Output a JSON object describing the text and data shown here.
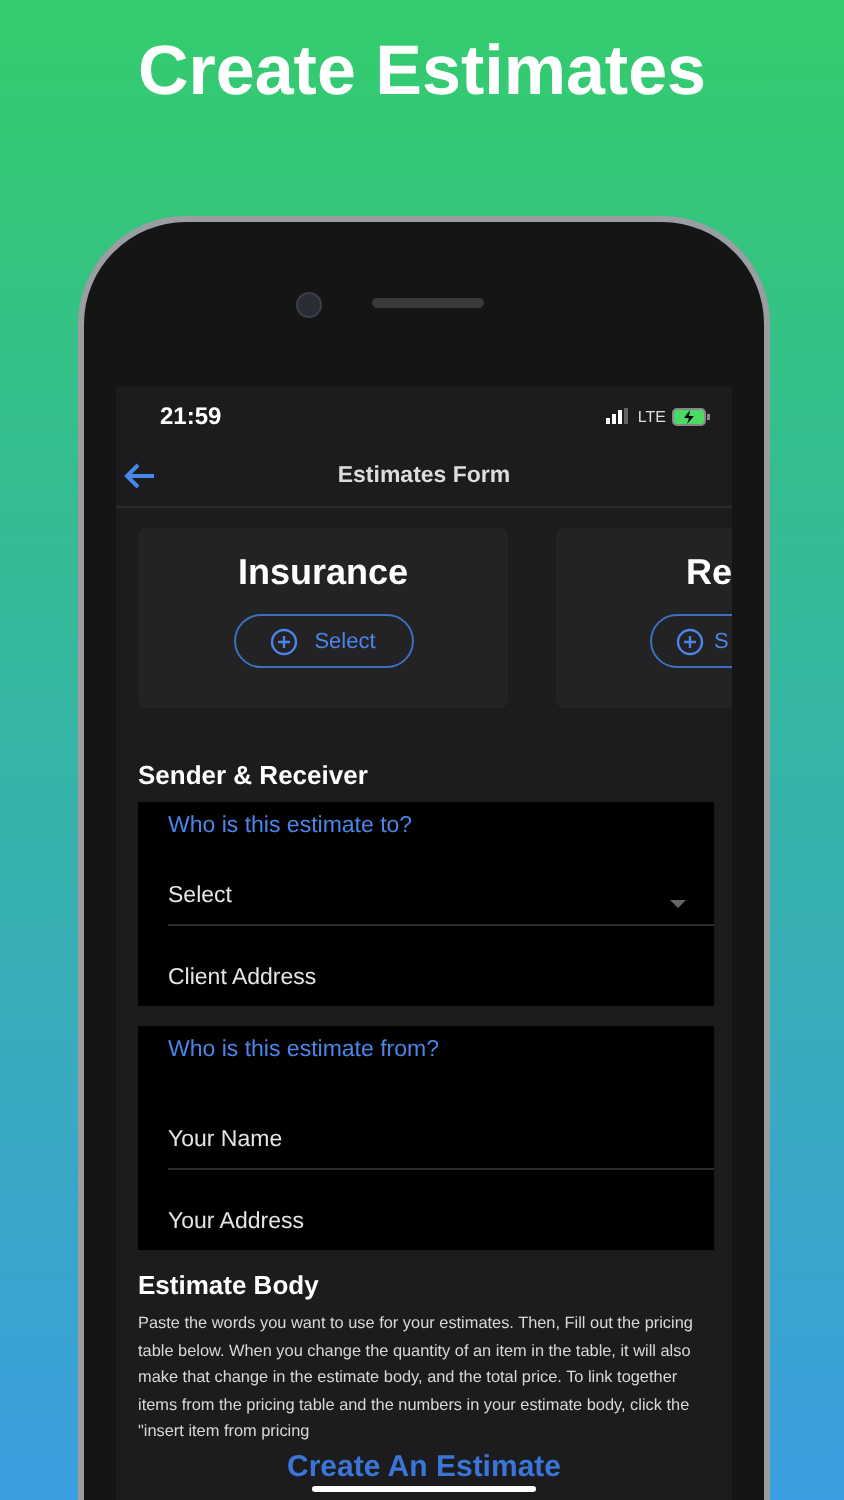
{
  "headline": "Create Estimates",
  "status_bar": {
    "time": "21:59",
    "network": "LTE"
  },
  "nav_bar": {
    "title": "Estimates Form"
  },
  "type_cards": [
    {
      "title": "Insurance",
      "button": "Select"
    },
    {
      "title": "Re",
      "button": "S"
    }
  ],
  "sender_receiver": {
    "title": "Sender & Receiver",
    "groups": [
      {
        "label": "Who is this estimate to?",
        "fields": [
          {
            "kind": "dropdown",
            "value": "Select"
          },
          {
            "kind": "text",
            "placeholder": "Client Address"
          }
        ]
      },
      {
        "label": "Who is this estimate from?",
        "fields": [
          {
            "kind": "text",
            "placeholder": "Your Name"
          },
          {
            "kind": "text",
            "placeholder": "Your Address"
          }
        ]
      }
    ]
  },
  "estimate_body": {
    "title": "Estimate Body",
    "text": "Paste the words you want to use for your estimates. Then, Fill out the pricing table below. When you change the quantity of an item in the table, it will also make that change in the estimate body, and the total price. To link together items from the pricing table and the numbers in your estimate body, click the \"insert item from pricing"
  },
  "create_button": "Create An Estimate"
}
